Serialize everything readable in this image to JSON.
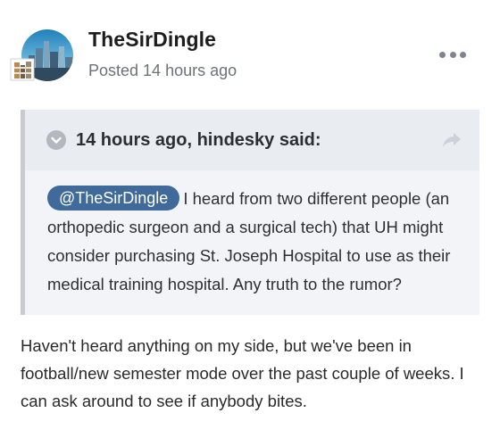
{
  "post": {
    "author": "TheSirDingle",
    "posted": "Posted 14 hours ago",
    "more_icon": "ellipsis-icon"
  },
  "quote": {
    "citation": "14 hours ago, hindesky said:",
    "collapse_icon": "chevron-down-circle-icon",
    "share_icon": "share-arrow-icon",
    "mention": "@TheSirDingle",
    "text": "I heard from two different people (an orthopedic surgeon and a surgical tech) that UH might consider purchasing St. Joseph Hospital to use as their  medical training hospital. Any truth to the rumor?"
  },
  "reply": {
    "text": "Haven't heard anything on my side, but we've been in football/new semester mode over the past couple of weeks. I can ask around to see if anybody bites."
  },
  "colors": {
    "mention_bg": "#3f6a9a",
    "quote_bg": "#f2f4f7",
    "quote_head_bg": "#e9edf2",
    "quote_border": "#c8ccd2",
    "muted_text": "#6c727a"
  }
}
